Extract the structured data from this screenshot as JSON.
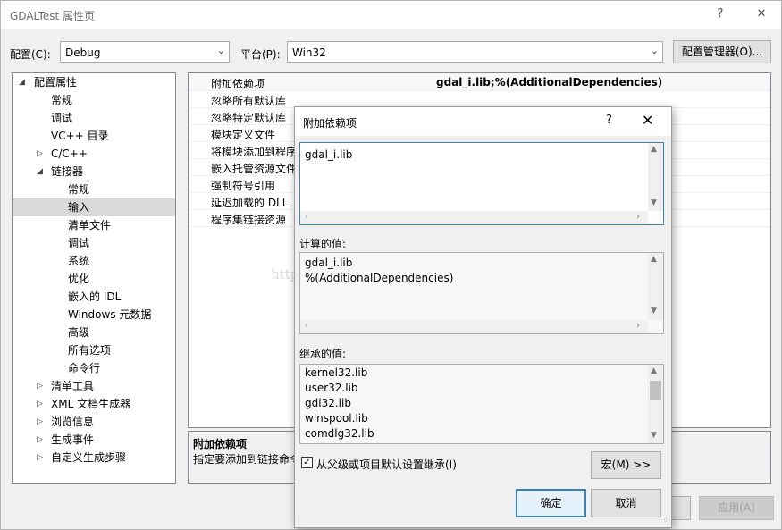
{
  "window": {
    "title": "GDALTest 属性页",
    "help_glyph": "?",
    "close_glyph": "✕"
  },
  "config": {
    "config_label": "配置(C):",
    "config_value": "Debug",
    "platform_label": "平台(P):",
    "platform_value": "Win32",
    "manager_button": "配置管理器(O)..."
  },
  "tree": {
    "items": [
      {
        "label": "配置属性",
        "expander": "◢"
      },
      {
        "label": "常规"
      },
      {
        "label": "调试"
      },
      {
        "label": "VC++ 目录"
      },
      {
        "label": "C/C++",
        "expander": "▷"
      },
      {
        "label": "链接器",
        "expander": "◢"
      },
      {
        "label": "常规"
      },
      {
        "label": "输入",
        "selected": true
      },
      {
        "label": "清单文件"
      },
      {
        "label": "调试"
      },
      {
        "label": "系统"
      },
      {
        "label": "优化"
      },
      {
        "label": "嵌入的 IDL"
      },
      {
        "label": "Windows 元数据"
      },
      {
        "label": "高级"
      },
      {
        "label": "所有选项"
      },
      {
        "label": "命令行"
      },
      {
        "label": "清单工具",
        "expander": "▷"
      },
      {
        "label": "XML 文档生成器",
        "expander": "▷"
      },
      {
        "label": "浏览信息",
        "expander": "▷"
      },
      {
        "label": "生成事件",
        "expander": "▷"
      },
      {
        "label": "自定义生成步骤",
        "expander": "▷"
      }
    ]
  },
  "grid": {
    "rows": [
      {
        "name": "附加依赖项",
        "value": "gdal_i.lib;%(AdditionalDependencies)"
      },
      {
        "name": "忽略所有默认库",
        "value": ""
      },
      {
        "name": "忽略特定默认库",
        "value": ""
      },
      {
        "name": "模块定义文件",
        "value": ""
      },
      {
        "name": "将模块添加到程序",
        "value": ""
      },
      {
        "name": "嵌入托管资源文件",
        "value": ""
      },
      {
        "name": "强制符号引用",
        "value": ""
      },
      {
        "name": "延迟加载的 DLL",
        "value": ""
      },
      {
        "name": "程序集链接资源",
        "value": ""
      }
    ]
  },
  "description": {
    "title": "附加依赖项",
    "text": "指定要添加到链接命令"
  },
  "main_buttons": {
    "apply": "应用(A)"
  },
  "dialog": {
    "title": "附加依赖项",
    "help_glyph": "?",
    "close_glyph": "✕",
    "edit_lines": [
      "gdal_i.lib"
    ],
    "computed_label": "计算的值:",
    "computed_lines": [
      "gdal_i.lib",
      "%(AdditionalDependencies)"
    ],
    "inherited_label": "继承的值:",
    "inherited_lines": [
      "kernel32.lib",
      "user32.lib",
      "gdi32.lib",
      "winspool.lib",
      "comdlg32.lib"
    ],
    "inherit_checkbox": "从父级或项目默认设置继承(I)",
    "inherit_checked": true,
    "macro_button": "宏(M) >>",
    "ok_button": "确定",
    "cancel_button": "取消"
  },
  "watermark": "http://blog.csdn.net/octdream"
}
